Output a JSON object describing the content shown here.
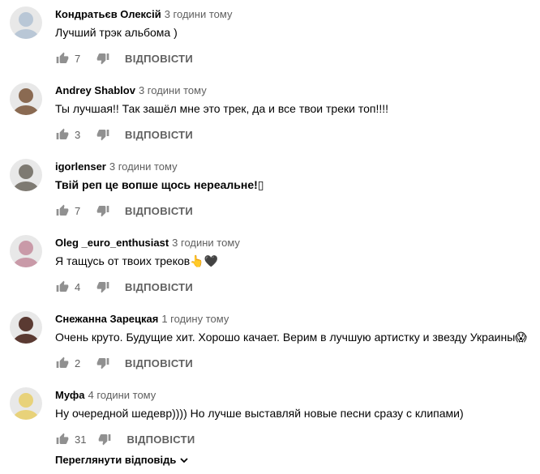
{
  "comments": [
    {
      "author": "Кондратьєв Олексій",
      "time": "3 години тому",
      "text": "Лучший трэк альбома )",
      "likes": "7",
      "reply": "ВІДПОВІСТИ",
      "avatar_color": "#b9c7d6",
      "text_bold": false
    },
    {
      "author": "Andrey Shablov",
      "time": "3 години тому",
      "text": "Ты лучшая!! Так зашёл мне это трек, да и все твои треки топ!!!!",
      "likes": "3",
      "reply": "ВІДПОВІСТИ",
      "avatar_color": "#8a6a52",
      "text_bold": false
    },
    {
      "author": "igorlenser",
      "time": "3 години тому",
      "text": "Твій реп це вопше щось нереальне!▯",
      "likes": "7",
      "reply": "ВІДПОВІСТИ",
      "avatar_color": "#7e7a72",
      "text_bold": true
    },
    {
      "author": "Oleg _euro_enthusiast",
      "time": "3 години тому",
      "text": "Я тащусь от твоих треков👆🖤",
      "likes": "4",
      "reply": "ВІДПОВІСТИ",
      "avatar_color": "#c99aa8",
      "text_bold": false
    },
    {
      "author": "Снежанна Зарецкая",
      "time": "1 годину тому",
      "text": "Очень круто. Будущие хит. Хорошо качает. Верим в лучшую артистку и звезду Украины😱",
      "likes": "2",
      "reply": "ВІДПОВІСТИ",
      "avatar_color": "#5a3a32",
      "text_bold": false
    },
    {
      "author": "Муфа",
      "time": "4 години тому",
      "text": "Ну очередной шедевр))))  Но лучше выставляй новые песни сразу с клипами)",
      "likes": "31",
      "reply": "ВІДПОВІСТИ",
      "avatar_color": "#e8d27a",
      "text_bold": false
    }
  ],
  "view_replies": "Переглянути відповідь",
  "colors": {
    "text": "#030303",
    "secondary": "#606060"
  }
}
